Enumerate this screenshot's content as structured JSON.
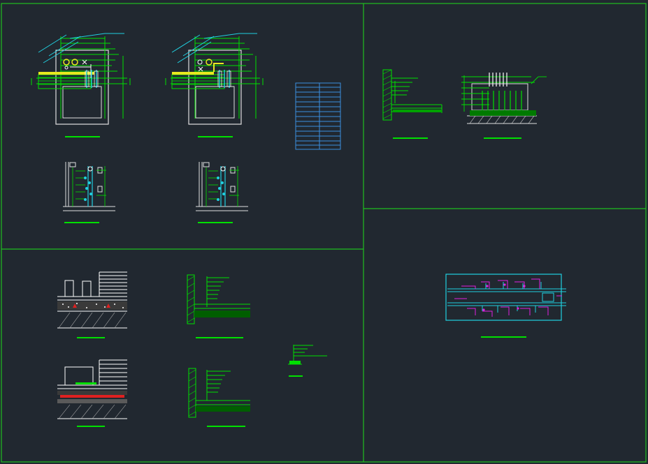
{
  "colors": {
    "background": "#212830",
    "frame": "#1fbf1f",
    "linework": "#00e000",
    "white": "#ffffff",
    "cyan": "#20d0e0",
    "magenta": "#e020e0",
    "yellow": "#e8e820",
    "red": "#e02020",
    "blue": "#3a8fe0",
    "grey": "#b0b0b0"
  },
  "panels": [
    {
      "id": "top-left",
      "label": ""
    },
    {
      "id": "top-right",
      "label": ""
    },
    {
      "id": "bottom-left",
      "label": ""
    },
    {
      "id": "bottom-right",
      "label": ""
    }
  ]
}
